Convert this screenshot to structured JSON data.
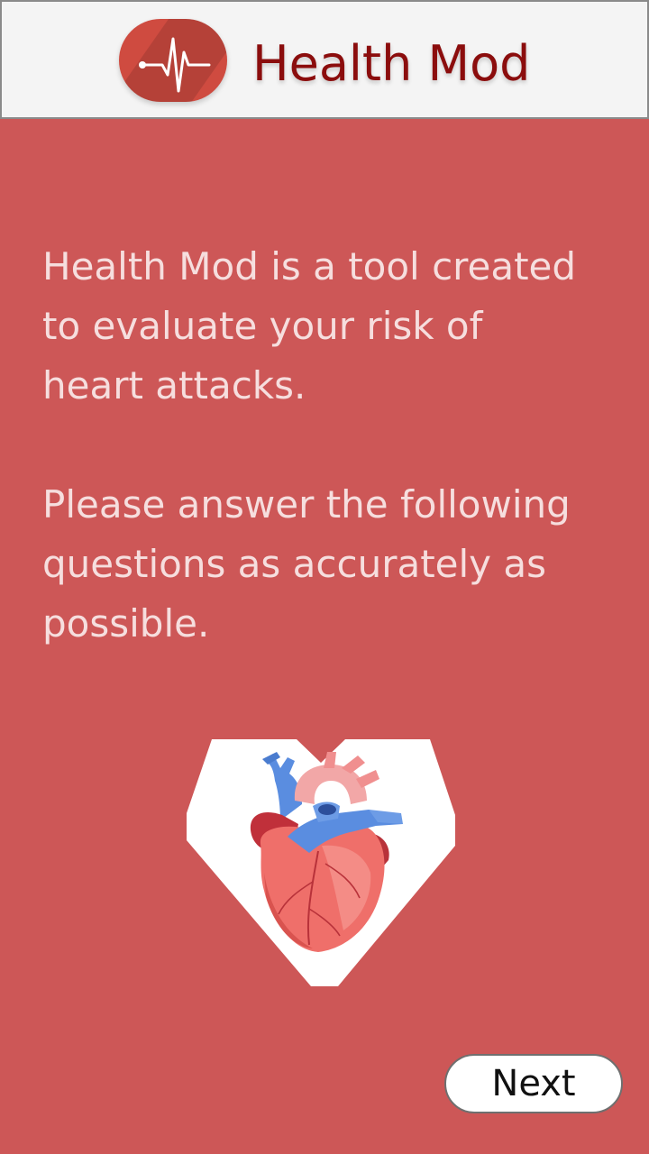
{
  "header": {
    "title": "Health Mod",
    "logo_icon": "heartbeat-pulse-icon",
    "logo_color": "#cf4b40",
    "title_color": "#8b0d0d"
  },
  "main": {
    "background_color": "#cd5757",
    "intro_line1": "Health Mod is a tool created",
    "intro_line2": "to evaluate your risk of",
    "intro_line3": "heart attacks.",
    "instruction_line1": "Please answer the following",
    "instruction_line2": "questions as accurately as",
    "instruction_line3": "possible.",
    "illustration_icon": "anatomical-heart-icon"
  },
  "footer": {
    "next_label": "Next"
  }
}
